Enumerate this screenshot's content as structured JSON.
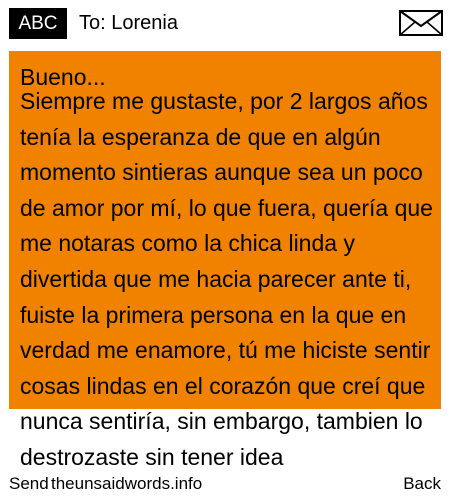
{
  "header": {
    "input_mode": "ABC",
    "to_label": "To: Lorenia",
    "icon": "envelope-icon"
  },
  "message": {
    "greeting": "Bueno...",
    "body": "Siempre me gustaste, por 2 largos años tenía la esperanza de que en algún momento sintieras aunque sea un poco de amor por mí, lo que fuera, quería que me notaras como la chica linda y divertida que me hacia parecer ante ti, fuiste la primera persona en la que en verdad me enamore, tú me hiciste sentir cosas lindas en el corazón que creí que nunca sentiría, sin embargo, tambien lo destrozaste sin tener idea",
    "background_color": "#f08200"
  },
  "softkeys": {
    "left": "Send",
    "center": "theunsaidwords.info",
    "right": "Back"
  }
}
